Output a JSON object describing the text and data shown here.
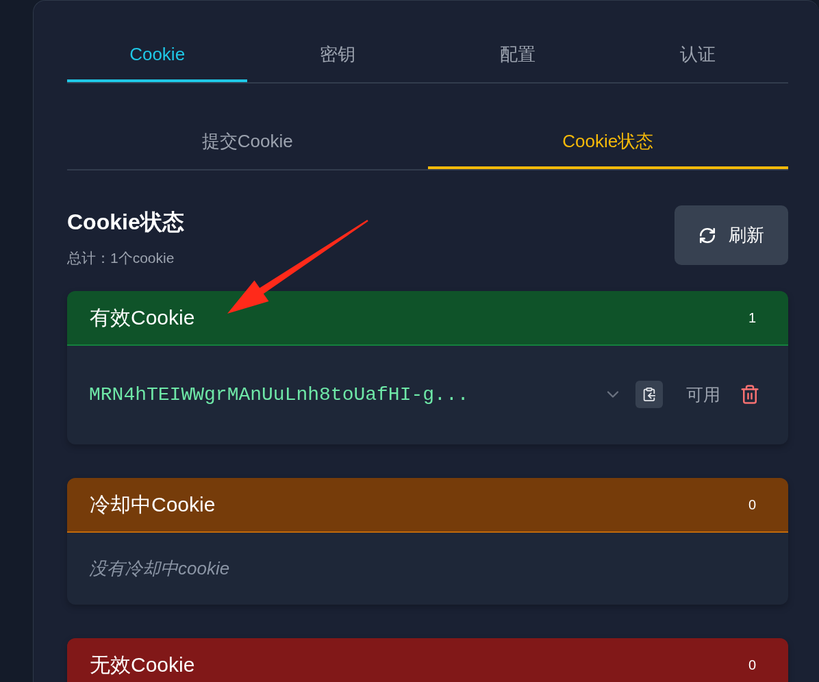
{
  "tabs": [
    {
      "label": "Cookie",
      "selected": true
    },
    {
      "label": "密钥",
      "selected": false
    },
    {
      "label": "配置",
      "selected": false
    },
    {
      "label": "认证",
      "selected": false
    }
  ],
  "sub_tabs": [
    {
      "label": "提交Cookie",
      "selected": false
    },
    {
      "label": "Cookie状态",
      "selected": true
    }
  ],
  "status_header": {
    "title": "Cookie状态",
    "summary": "总计：1个cookie",
    "refresh_button": "刷新"
  },
  "sections": [
    {
      "kind": "valid",
      "color": "#0f5329",
      "title": "有效Cookie",
      "count": "1",
      "cookies": [
        {
          "value": "MRN4hTEIWWgrMAnUuLnh8toUafHI-g...",
          "status": "可用"
        }
      ]
    },
    {
      "kind": "cooling",
      "color": "#763c0a",
      "title": "冷却中Cookie",
      "count": "0",
      "empty_text": "没有冷却中cookie"
    },
    {
      "kind": "invalid",
      "color": "#811818",
      "title": "无效Cookie",
      "count": "0"
    }
  ]
}
